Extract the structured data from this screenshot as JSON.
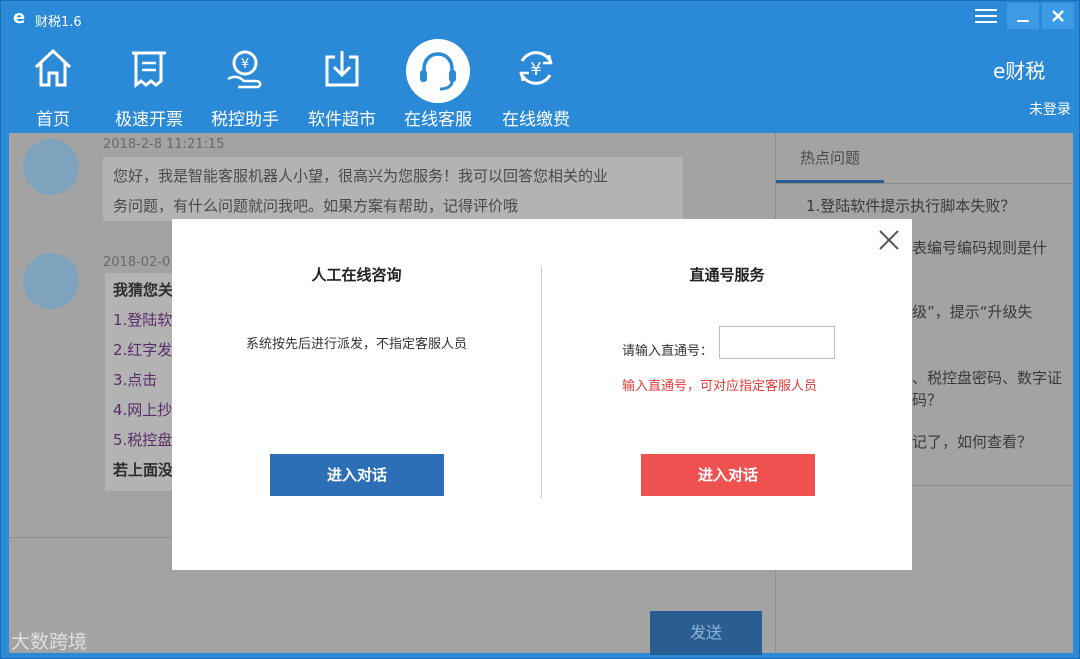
{
  "window": {
    "title": "财税1.6",
    "logo_char": "e"
  },
  "nav": {
    "items": [
      {
        "label": "首页",
        "icon": "home-icon"
      },
      {
        "label": "极速开票",
        "icon": "receipt-icon"
      },
      {
        "label": "税控助手",
        "icon": "tax-assistant-icon"
      },
      {
        "label": "软件超市",
        "icon": "download-icon"
      },
      {
        "label": "在线客服",
        "icon": "headset-icon",
        "active": true
      },
      {
        "label": "在线缴费",
        "icon": "yen-refresh-icon"
      }
    ],
    "brand": "e财税",
    "login_status": "未登录"
  },
  "chat": {
    "messages": [
      {
        "timestamp": "2018-2-8 11:21:15",
        "text_line1": "您好，我是智能客服机器人小望，很高兴为您服务！我可以回答您相关的业",
        "text_line2": "务问题，有什么问题就问我吧。如果方案有帮助，记得评价哦"
      },
      {
        "timestamp": "2018-02-0"
      }
    ],
    "suggestions": [
      "我猜您关",
      "1.登陆软",
      "2.红字发",
      "3.点击",
      "4.网上抄",
      "5.税控盘",
      "若上面没"
    ],
    "send_label": "发送"
  },
  "hot": {
    "tab_label": "热点问题",
    "items": [
      "1.登陆软件提示执行脚本失败？",
      "表编号编码规则是什",
      "级”，提示“升级失",
      "、税控盘密码、数字证",
      "码？",
      "记了，如何查看？"
    ]
  },
  "modal": {
    "left": {
      "title": "人工在线咨询",
      "desc": "系统按先后进行派发，不指定客服人员",
      "button": "进入对话"
    },
    "right": {
      "title": "直通号服务",
      "input_label": "请输入直通号：",
      "input_value": "",
      "hint": "输入直通号，可对应指定客服人员",
      "button": "进入对话"
    }
  },
  "watermark": "大数跨境",
  "colors": {
    "accent": "#2b8ad8",
    "primary_button": "#2c6fb7",
    "danger_button": "#ef5050",
    "hint_text": "#e53b3b"
  }
}
